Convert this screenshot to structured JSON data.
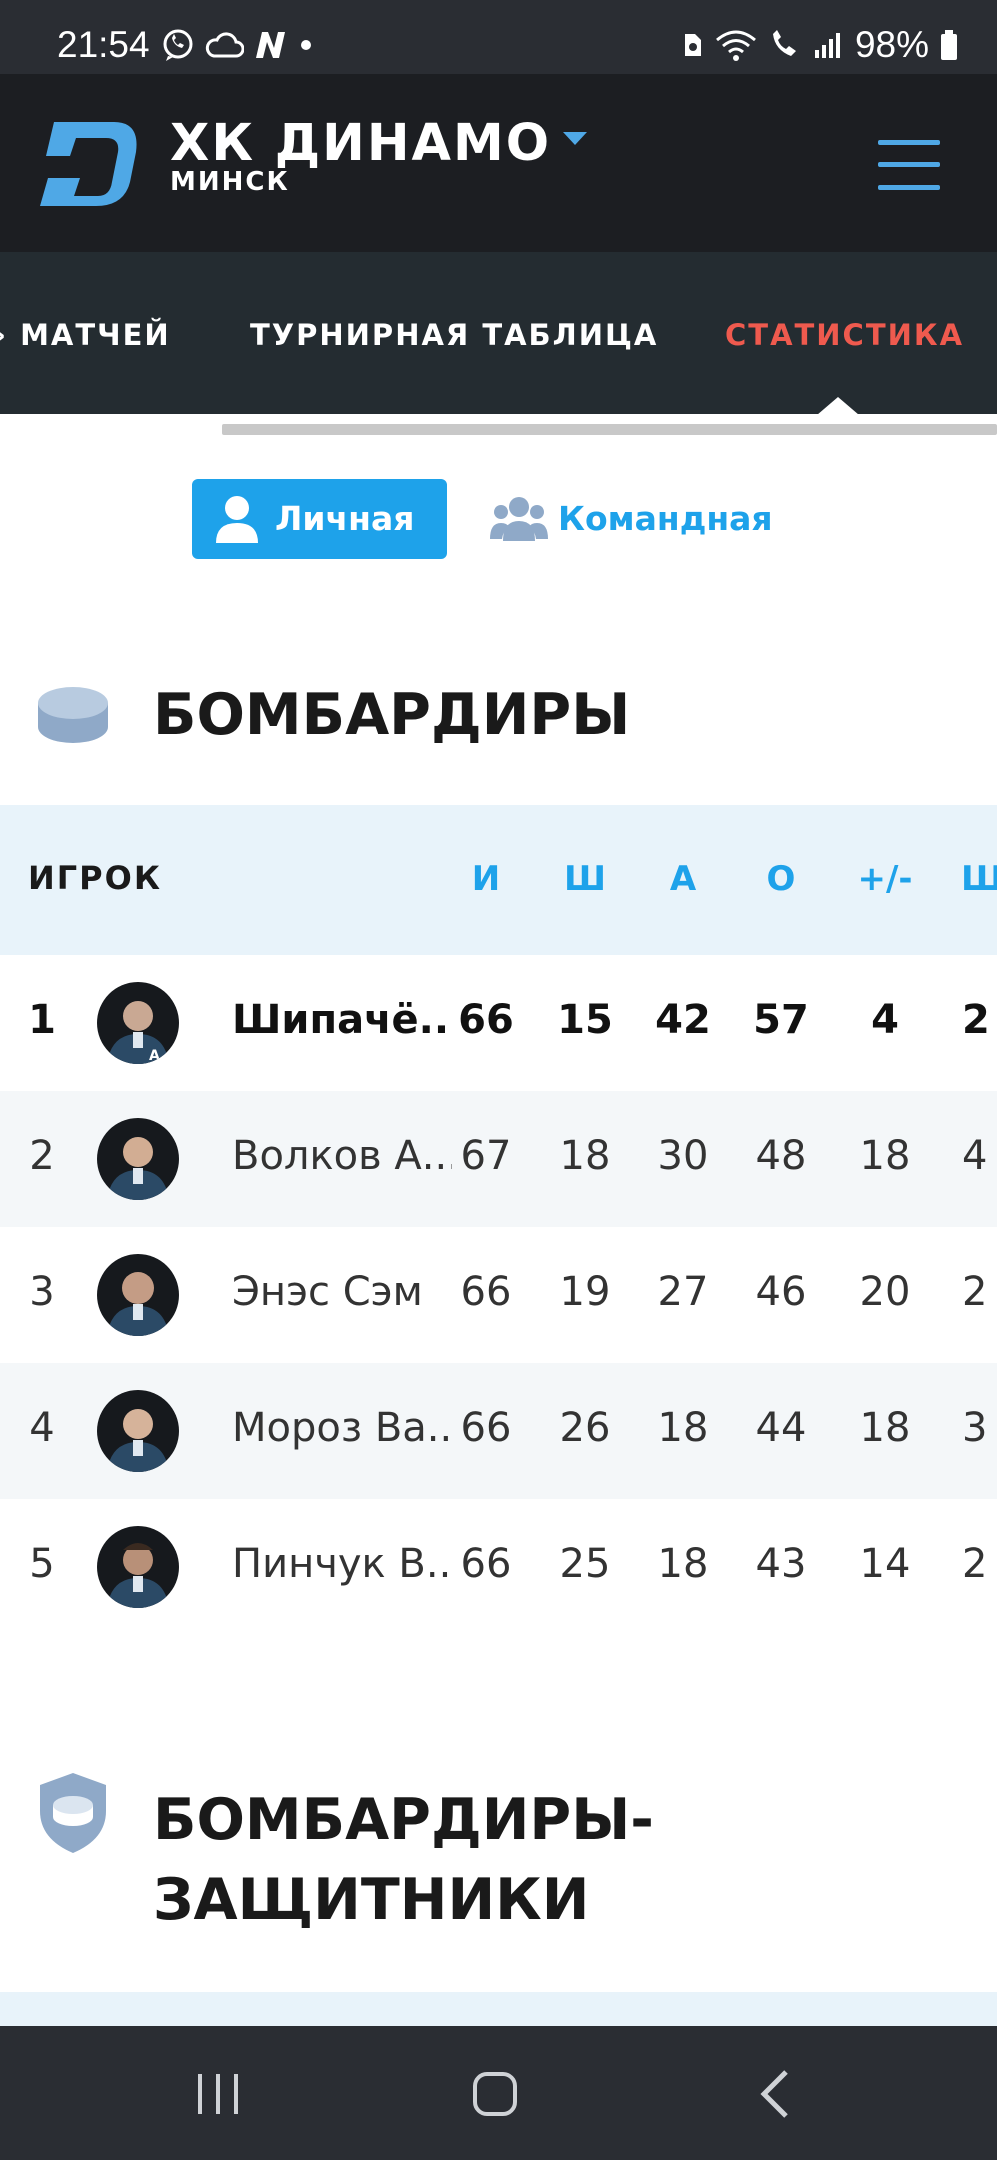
{
  "status_bar": {
    "time": "21:54",
    "battery": "98%"
  },
  "header": {
    "team_name": "ХК ДИНАМО",
    "city": "МИНСК"
  },
  "tabs": [
    {
      "label": "МАТЧЕЙ"
    },
    {
      "label": "ТУРНИРНАЯ ТАБЛИЦА"
    },
    {
      "label": "СТАТИСТИКА"
    }
  ],
  "toggle": {
    "personal": "Личная",
    "team": "Командная"
  },
  "sections": [
    {
      "title": "БОМБАРДИРЫ"
    },
    {
      "title_line1": "БОМБАРДИРЫ-",
      "title_line2": "ЗАЩИТНИКИ"
    }
  ],
  "table": {
    "headers": [
      "ИГРОК",
      "И",
      "Ш",
      "А",
      "О",
      "+/-",
      "Ш"
    ],
    "rows": [
      {
        "rank": "1",
        "name": "Шипачё...",
        "games": "66",
        "goals": "15",
        "assists": "42",
        "points": "57",
        "plus_minus": "4",
        "extra": "2"
      },
      {
        "rank": "2",
        "name": "Волков А...",
        "games": "67",
        "goals": "18",
        "assists": "30",
        "points": "48",
        "plus_minus": "18",
        "extra": "4"
      },
      {
        "rank": "3",
        "name": "Энэс Сэм",
        "games": "66",
        "goals": "19",
        "assists": "27",
        "points": "46",
        "plus_minus": "20",
        "extra": "2"
      },
      {
        "rank": "4",
        "name": "Мороз Ва...",
        "games": "66",
        "goals": "26",
        "assists": "18",
        "points": "44",
        "plus_minus": "18",
        "extra": "3"
      },
      {
        "rank": "5",
        "name": "Пинчук В...",
        "games": "66",
        "goals": "25",
        "assists": "18",
        "points": "43",
        "plus_minus": "14",
        "extra": "2"
      }
    ]
  },
  "colors": {
    "accent": "#1ea2ea",
    "active_tab": "#ef5a4e",
    "header_bg": "#1c1e22",
    "tabs_bg": "#242c31"
  },
  "icons": [
    "menu-icon",
    "user-icon",
    "users-icon",
    "puck-icon",
    "shield-icon"
  ]
}
